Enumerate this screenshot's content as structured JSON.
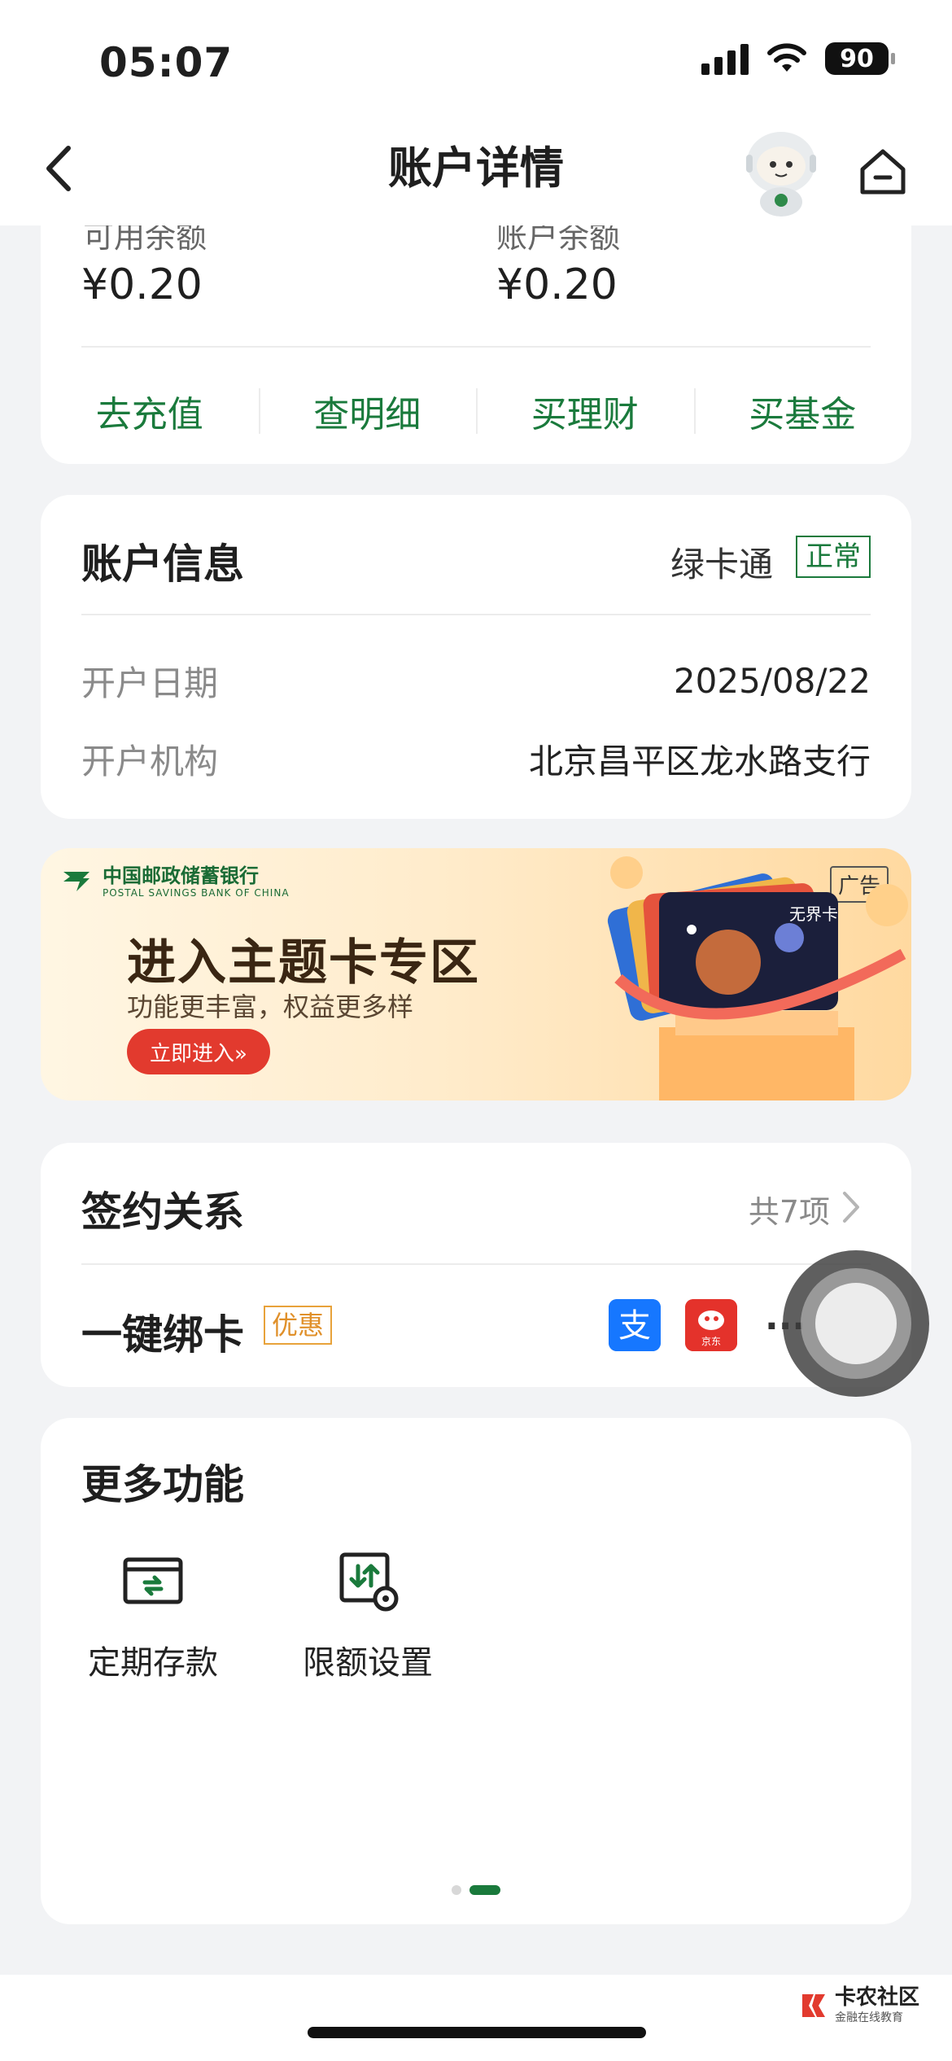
{
  "status_bar": {
    "time": "05:07",
    "battery": "90"
  },
  "nav": {
    "title": "账户详情"
  },
  "balance": {
    "available_label": "可用余额",
    "available_value": "¥0.20",
    "account_label": "账户余额",
    "account_value": "¥0.20",
    "actions": [
      "去充值",
      "查明细",
      "买理财",
      "买基金"
    ]
  },
  "account_info": {
    "title": "账户信息",
    "type": "绿卡通",
    "status": "正常",
    "rows": [
      {
        "label": "开户日期",
        "value": "2025/08/22"
      },
      {
        "label": "开户机构",
        "value": "北京昌平区龙水路支行"
      }
    ]
  },
  "banner": {
    "bank_name": "中国邮政储蓄银行",
    "bank_name_en": "POSTAL SAVINGS BANK OF CHINA",
    "ad_tag": "广告",
    "title": "进入主题卡专区",
    "subtitle": "功能更丰富，权益更多样",
    "button": "立即进入»",
    "card_label": "无界卡"
  },
  "sign": {
    "title": "签约关系",
    "count": "共7项",
    "bind_title": "一键绑卡",
    "promo": "优惠",
    "more": "···",
    "jd_label": "京东"
  },
  "more_functions": {
    "title": "更多功能",
    "items": [
      "定期存款",
      "限额设置"
    ],
    "pager": {
      "pages": 2,
      "active": 2
    }
  },
  "watermark": {
    "name": "卡农社区",
    "sub": "金融在线教育"
  },
  "colors": {
    "brand_green": "#1a7a3c",
    "promo_orange": "#e0902a",
    "banner_red": "#e23a2e"
  }
}
